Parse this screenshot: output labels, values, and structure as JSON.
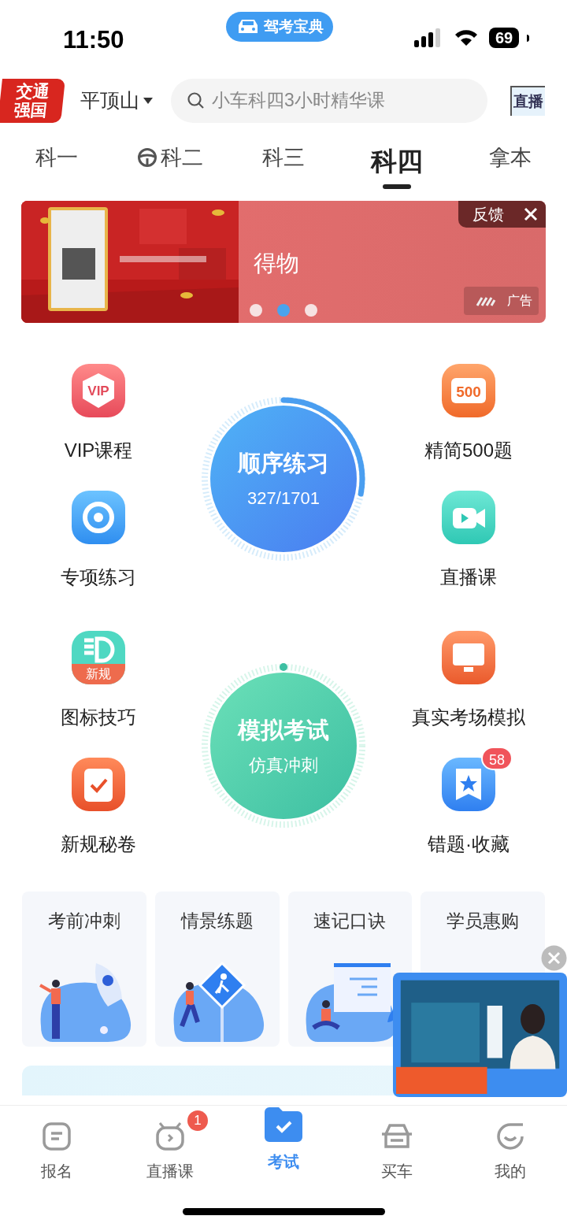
{
  "status_bar": {
    "time": "11:50",
    "app_pill": "驾考宝典",
    "battery": "69"
  },
  "header": {
    "logo": "交通强国",
    "city": "平顶山",
    "search_placeholder": "小车科四3小时精华课",
    "live_button": "直播"
  },
  "tabs": [
    {
      "label": "科一",
      "selected": false,
      "kind": "plain"
    },
    {
      "label": "科二",
      "selected": false,
      "kind": "wheel"
    },
    {
      "label": "科三",
      "selected": false,
      "kind": "plain"
    },
    {
      "label": "科四",
      "selected": true,
      "kind": "plain"
    },
    {
      "label": "拿本",
      "selected": false,
      "kind": "plain"
    }
  ],
  "banner": {
    "kind": "picture",
    "title": "得物",
    "feedback": "反馈",
    "ad_label": "广告",
    "dots": [
      {
        "selected": false
      },
      {
        "selected": true
      },
      {
        "selected": false
      }
    ]
  },
  "practice_blocks": [
    {
      "circle": {
        "title": "顺序练习",
        "subtitle": "327/1701",
        "kind": "blue",
        "level": 0.28
      },
      "features": [
        {
          "label": "VIP课程",
          "kind": "vip",
          "icon_text": "VIP"
        },
        {
          "label": "精简500题",
          "kind": "num",
          "icon_text": "500"
        },
        {
          "label": "专项练习",
          "kind": "target"
        },
        {
          "label": "直播课",
          "kind": "video"
        }
      ]
    },
    {
      "circle": {
        "title": "模拟考试",
        "subtitle": "仿真冲刺",
        "kind": "green"
      },
      "features": [
        {
          "label": "图标技巧",
          "kind": "rule",
          "icon_text": "新规"
        },
        {
          "label": "真实考场模拟",
          "kind": "monitor"
        },
        {
          "label": "新规秘卷",
          "kind": "clipboard"
        },
        {
          "label": "错题·收藏",
          "kind": "star",
          "badge": "58"
        }
      ]
    }
  ],
  "cards": [
    {
      "title": "考前冲刺",
      "kind": "rocket"
    },
    {
      "title": "情景练题",
      "kind": "sign"
    },
    {
      "title": "速记口诀",
      "kind": "board"
    },
    {
      "title": "学员惠购",
      "kind": "hidden"
    }
  ],
  "bottom_nav": [
    {
      "label": "报名",
      "selected": false,
      "kind": "form"
    },
    {
      "label": "直播课",
      "selected": false,
      "kind": "tv",
      "badge": "1"
    },
    {
      "label": "考试",
      "selected": true,
      "kind": "folder"
    },
    {
      "label": "买车",
      "selected": false,
      "kind": "car"
    },
    {
      "label": "我的",
      "selected": false,
      "kind": "smile"
    }
  ]
}
